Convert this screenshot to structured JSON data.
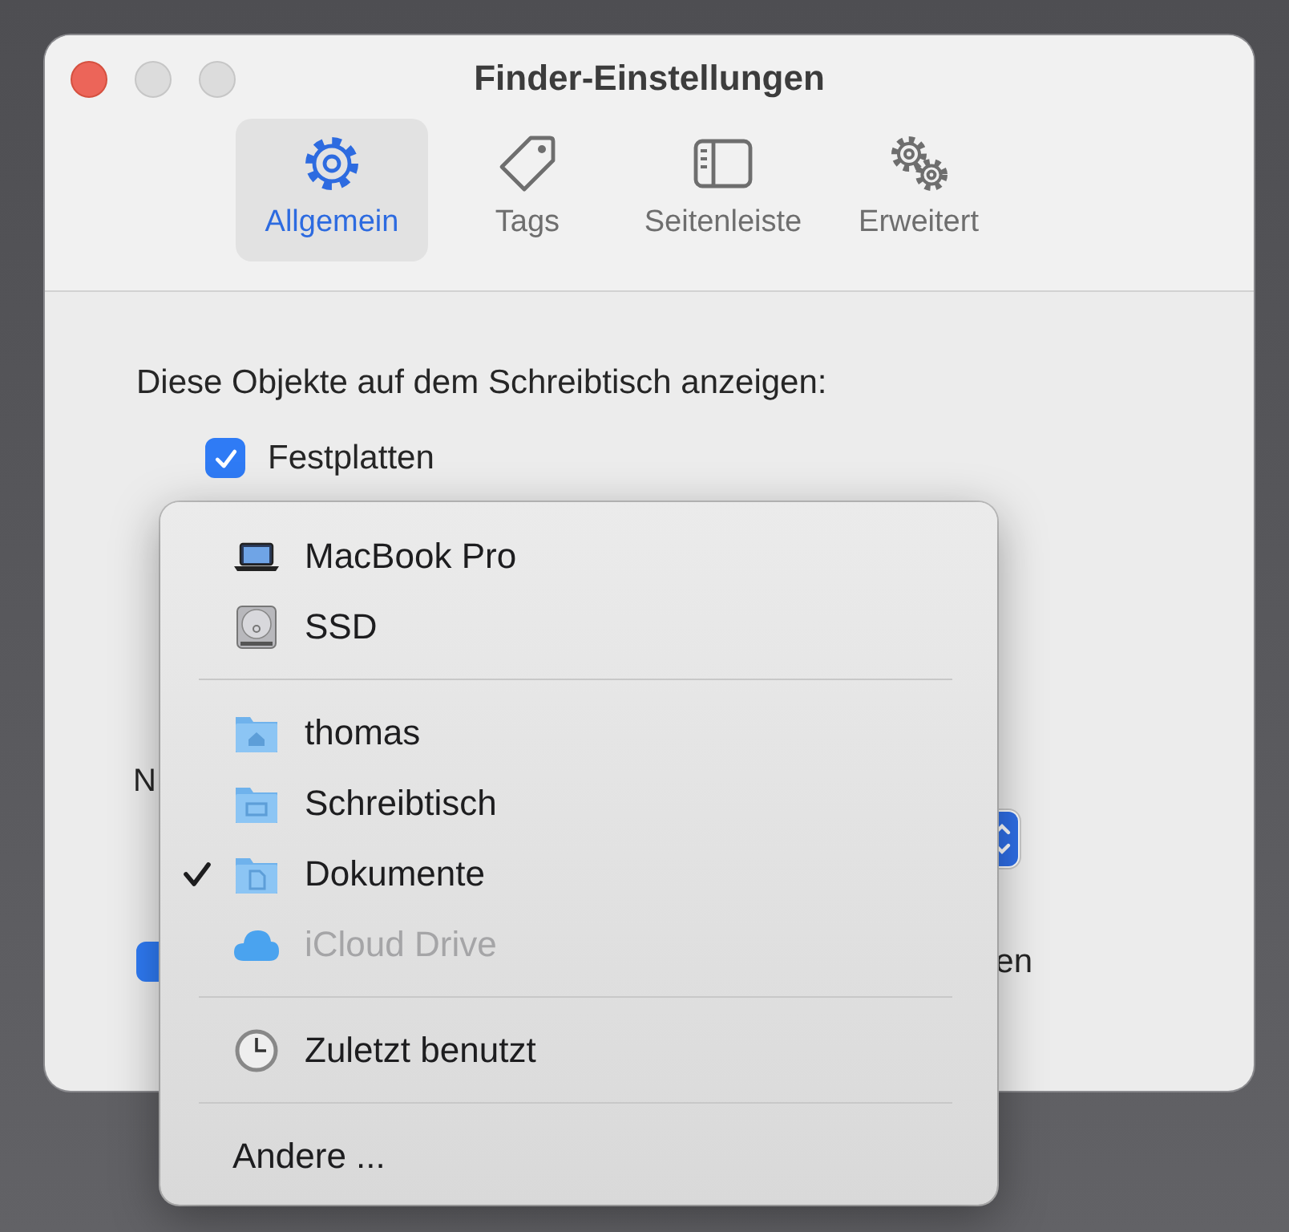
{
  "window": {
    "title": "Finder-Einstellungen"
  },
  "tabs": [
    {
      "label": "Allgemein",
      "selected": true
    },
    {
      "label": "Tags",
      "selected": false
    },
    {
      "label": "Seitenleiste",
      "selected": false
    },
    {
      "label": "Erweitert",
      "selected": false
    }
  ],
  "desktop_section": {
    "label": "Diese Objekte auf dem Schreibtisch anzeigen:",
    "options": [
      {
        "label": "Festplatten",
        "checked": true
      }
    ]
  },
  "new_window_label": "N",
  "bottom_option": {
    "label": "en",
    "checked": true
  },
  "menu": {
    "entries": [
      {
        "kind": "item",
        "label": "MacBook Pro",
        "selected": false,
        "disabled": false
      },
      {
        "kind": "item",
        "label": "SSD",
        "selected": false,
        "disabled": false
      },
      {
        "kind": "separator"
      },
      {
        "kind": "item",
        "label": "thomas",
        "selected": false,
        "disabled": false
      },
      {
        "kind": "item",
        "label": "Schreibtisch",
        "selected": false,
        "disabled": false
      },
      {
        "kind": "item",
        "label": "Dokumente",
        "selected": true,
        "disabled": false
      },
      {
        "kind": "item",
        "label": "iCloud Drive",
        "selected": false,
        "disabled": true
      },
      {
        "kind": "separator"
      },
      {
        "kind": "item",
        "label": "Zuletzt benutzt",
        "selected": false,
        "disabled": false
      },
      {
        "kind": "separator"
      },
      {
        "kind": "item",
        "label": "Andere ...",
        "selected": false,
        "disabled": false
      }
    ]
  }
}
